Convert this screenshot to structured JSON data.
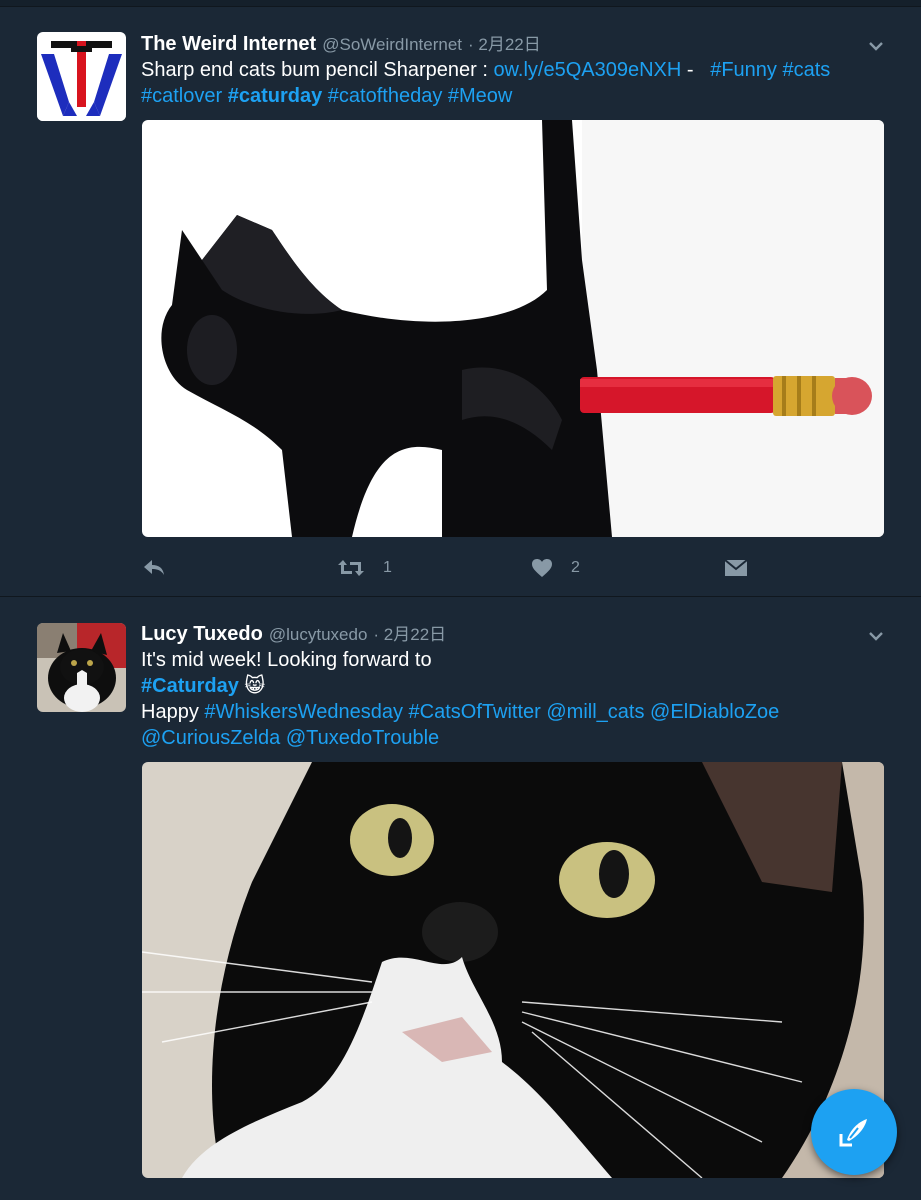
{
  "tweets": [
    {
      "name": "The Weird Internet",
      "handle": "@SoWeirdInternet",
      "date": "· 2月22日",
      "text": {
        "line1_plain": "Sharp end cats bum pencil Sharpener : ",
        "line1_link": "ow.ly/e5QA309eNXH",
        "line1_sep": " -   ",
        "line1_tag1": "#Funny",
        "line1_tag2": "#cats",
        "line2_tag1": "#catlover",
        "line2_tag2": "#caturday",
        "line2_tag3": "#catoftheday",
        "line2_tag4": "#Meow"
      },
      "retweet_count": "1",
      "like_count": "2"
    },
    {
      "name": "Lucy Tuxedo",
      "handle": "@lucytuxedo",
      "date": "· 2月22日",
      "text": {
        "line1": "It's mid week! Looking forward to",
        "line2_tag": "#Caturday",
        "line2_emoji": "😸",
        "line3_plain": "Happy ",
        "line3_tag1": "#WhiskersWednesday",
        "line3_tag2": "#CatsOfTwitter",
        "line3_mention1": "@mill_cats",
        "line3_mention2": "@ElDiabloZoe",
        "line4_mention1": "@CuriousZelda",
        "line4_mention2": "@TuxedoTrouble"
      }
    }
  ],
  "icons": {
    "reply": "reply-icon",
    "retweet": "retweet-icon",
    "like": "heart-icon",
    "dm": "envelope-icon",
    "caret": "chevron-down-icon",
    "compose": "compose-icon"
  },
  "colors": {
    "background": "#1b2836",
    "link": "#1da1f2",
    "secondary": "#8899a6"
  }
}
